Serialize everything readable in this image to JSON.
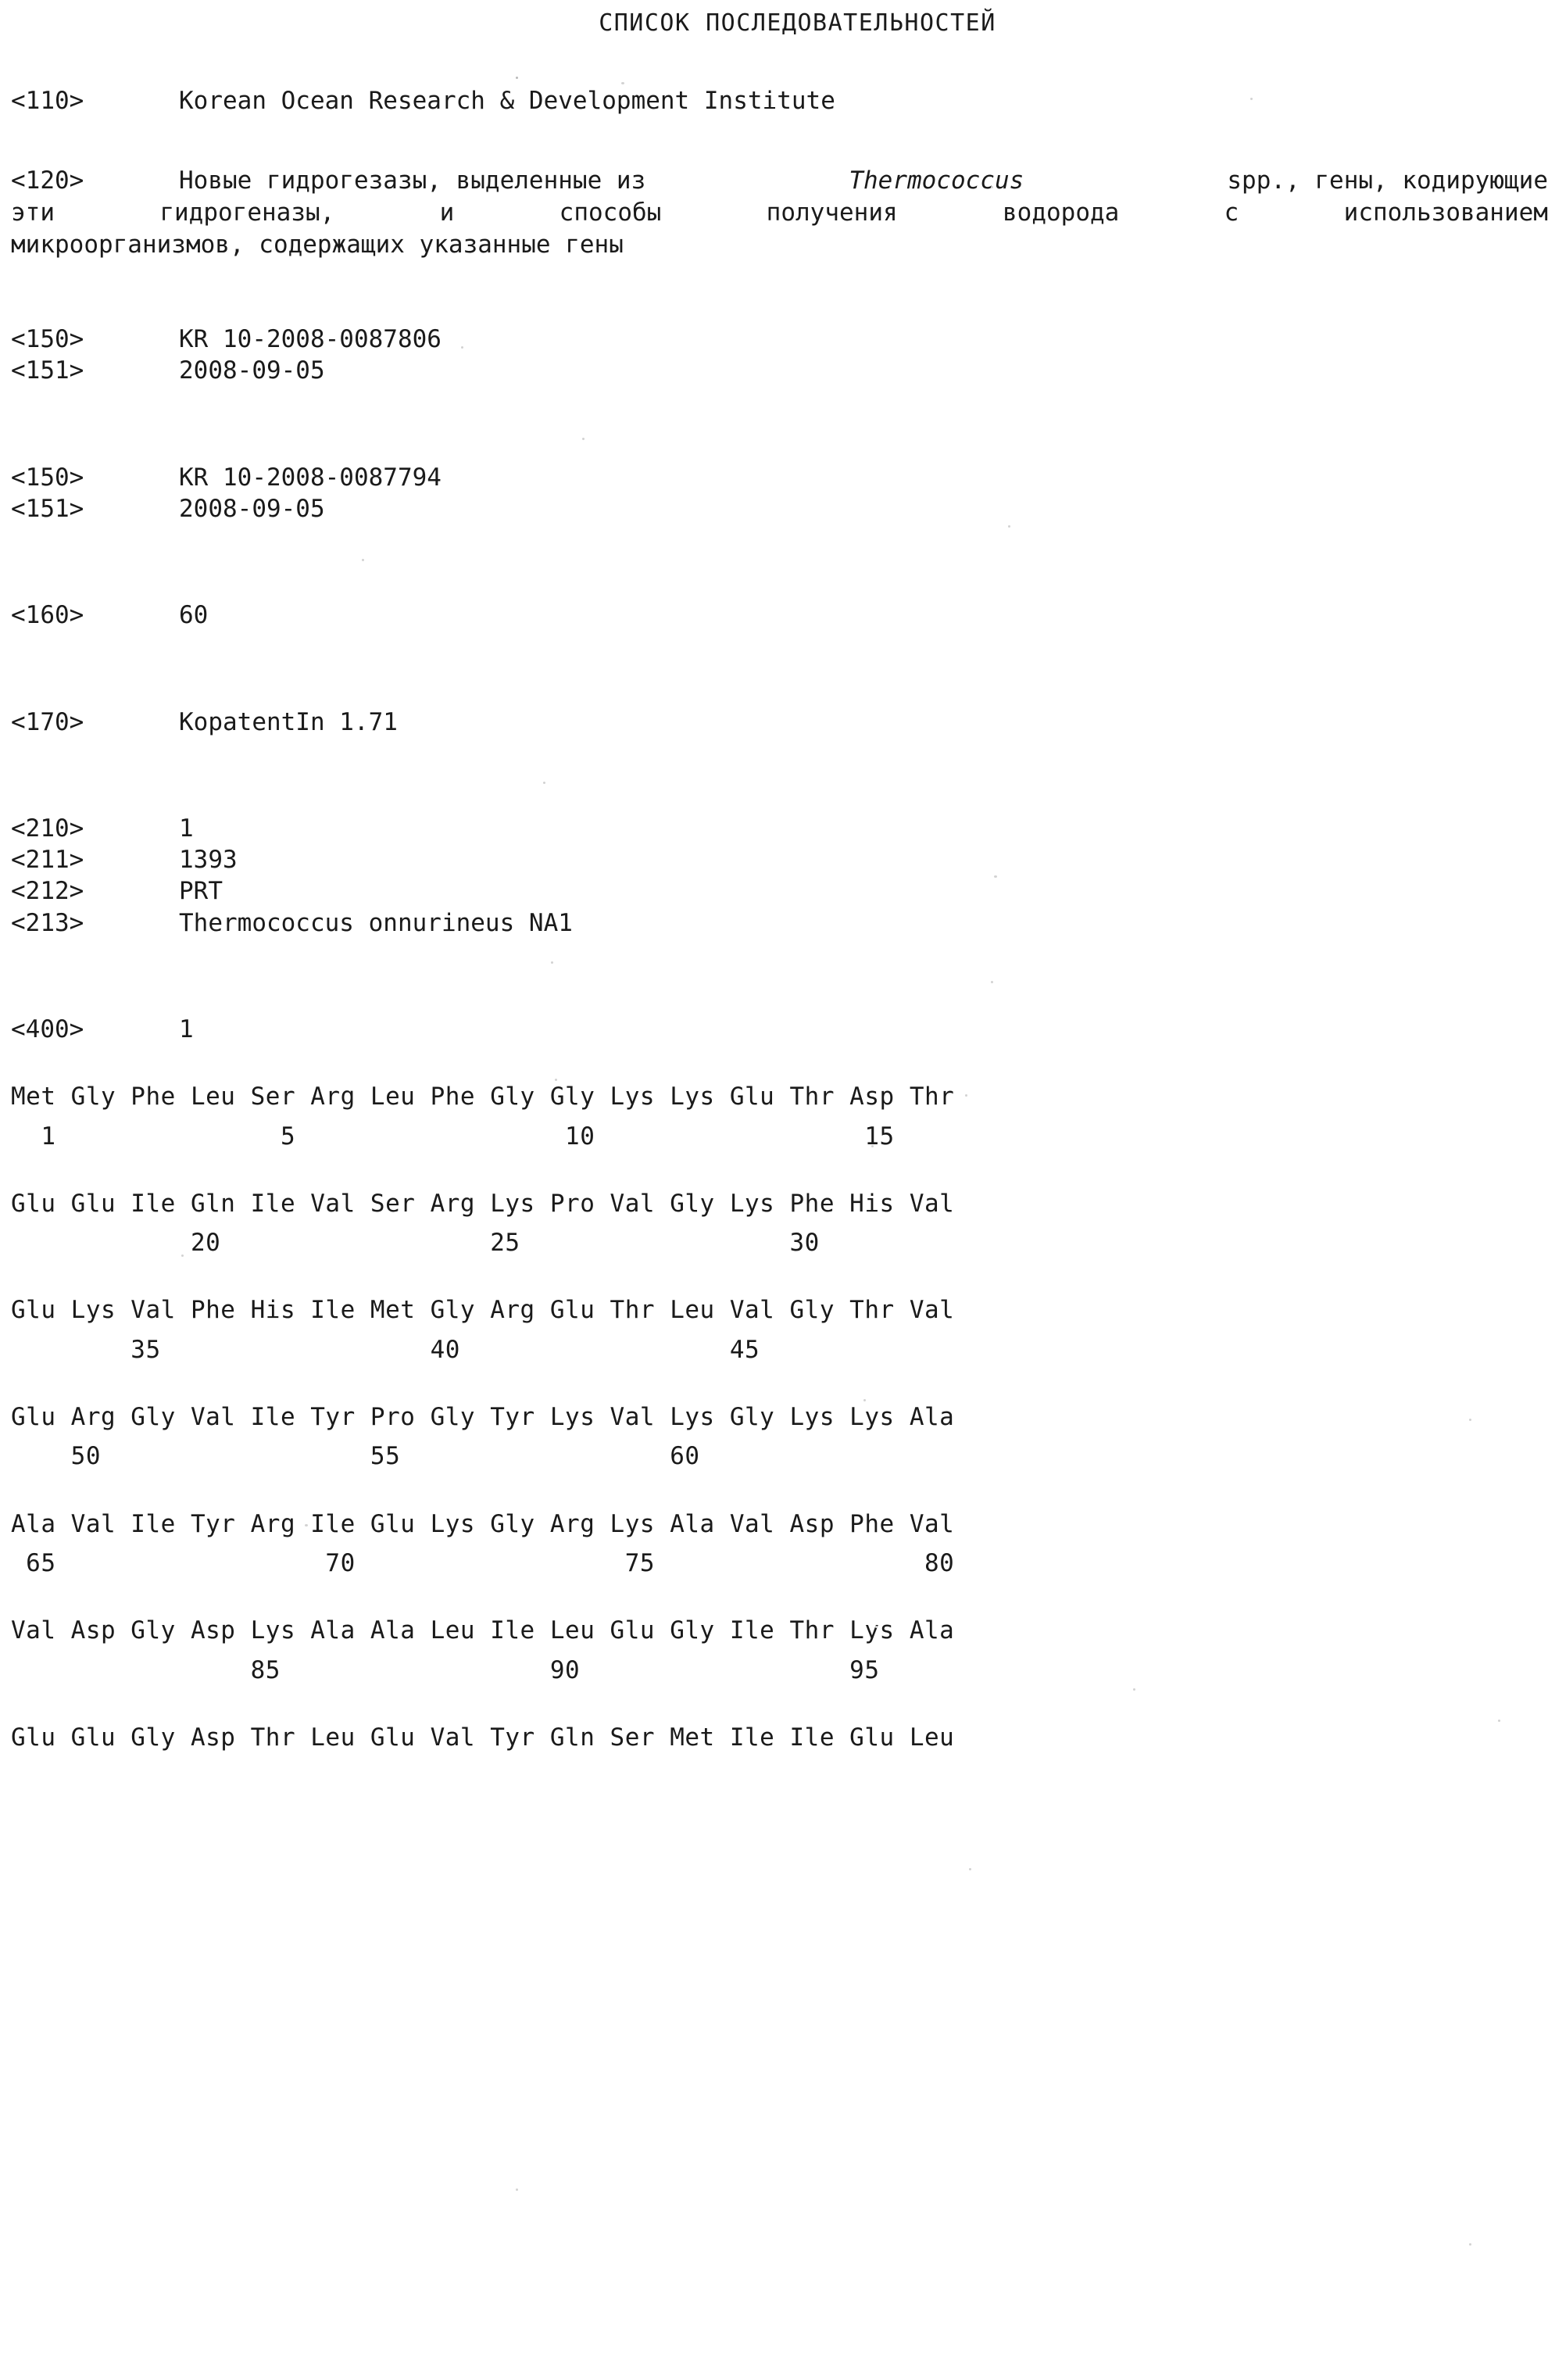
{
  "document": {
    "title": "СПИСОК ПОСЛЕДОВАТЕЛЬНОСТЕЙ"
  },
  "fields": {
    "applicant": {
      "tag": "<110>",
      "value": "Korean Ocean Research & Development Institute"
    },
    "invention_title": {
      "tag": "<120>",
      "line1_part1": "Новые гидрогезазы, выделенные из",
      "line1_italic": "Thermococcus",
      "line1_part2": "spp., гены, кодирующие",
      "line2_words": [
        "эти",
        "гидрогеназы,",
        "и",
        "способы",
        "получения",
        "водорода",
        "с",
        "использованием"
      ],
      "line3": "микроорганизмов, содержащих указанные гены"
    },
    "priority_1": {
      "number_tag": "<150>",
      "number_value": "KR 10-2008-0087806",
      "date_tag": "<151>",
      "date_value": "2008-09-05"
    },
    "priority_2": {
      "number_tag": "<150>",
      "number_value": "KR 10-2008-0087794",
      "date_tag": "<151>",
      "date_value": "2008-09-05"
    },
    "number_of_seq": {
      "tag": "<160>",
      "value": "60"
    },
    "software": {
      "tag": "<170>",
      "value": "KopatentIn 1.71"
    },
    "seq_id": {
      "tag": "<210>",
      "value": "1"
    },
    "length": {
      "tag": "<211>",
      "value": "1393"
    },
    "type": {
      "tag": "<212>",
      "value": "PRT"
    },
    "organism": {
      "tag": "<213>",
      "value": "Thermococcus onnurineus NA1"
    },
    "sequence_header": {
      "tag": "<400>",
      "value": "1"
    }
  },
  "sequence_blocks": [
    {
      "residues": "Met Gly Phe Leu Ser Arg Leu Phe Gly Gly Lys Lys Glu Thr Asp Thr",
      "numbers": "  1               5                  10                  15"
    },
    {
      "residues": "Glu Glu Ile Gln Ile Val Ser Arg Lys Pro Val Gly Lys Phe His Val",
      "numbers": "            20                  25                  30"
    },
    {
      "residues": "Glu Lys Val Phe His Ile Met Gly Arg Glu Thr Leu Val Gly Thr Val",
      "numbers": "        35                  40                  45"
    },
    {
      "residues": "Glu Arg Gly Val Ile Tyr Pro Gly Tyr Lys Val Lys Gly Lys Lys Ala",
      "numbers": "    50                  55                  60"
    },
    {
      "residues": "Ala Val Ile Tyr Arg Ile Glu Lys Gly Arg Lys Ala Val Asp Phe Val",
      "numbers": " 65                  70                  75                  80"
    },
    {
      "residues": "Val Asp Gly Asp Lys Ala Ala Leu Ile Leu Glu Gly Ile Thr Lys Ala",
      "numbers": "                85                  90                  95"
    },
    {
      "residues": "Glu Glu Gly Asp Thr Leu Glu Val Tyr Gln Ser Met Ile Ile Glu Leu",
      "numbers": ""
    }
  ]
}
